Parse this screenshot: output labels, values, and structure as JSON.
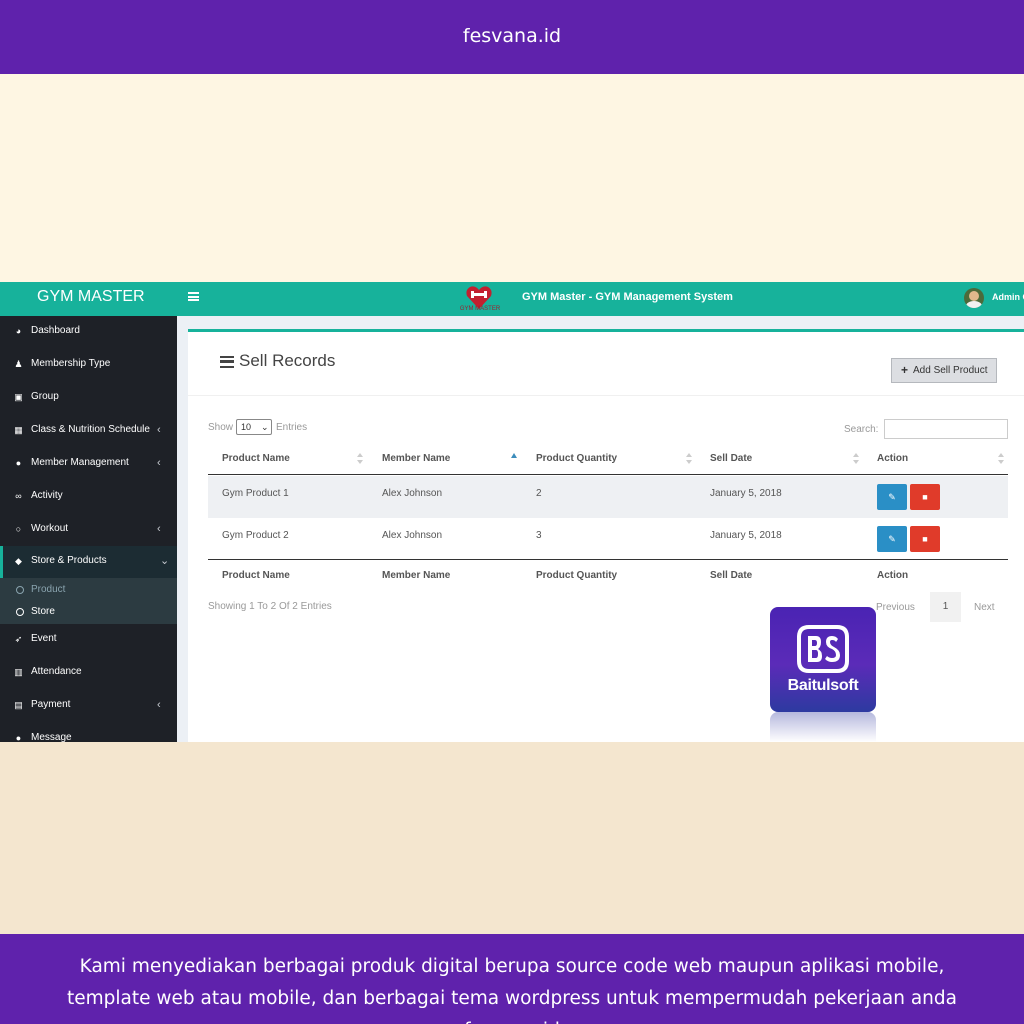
{
  "banner": {
    "top_text": "fesvana.id",
    "bottom_lines": [
      "Kami menyediakan berbagai produk digital berupa source code web maupun aplikasi mobile,",
      "template web atau mobile, dan berbagai tema wordpress untuk mempermudah pekerjaan anda",
      "fesvana.id"
    ]
  },
  "header": {
    "brand": "GYM MASTER",
    "logo_caption": "GYM MASTER",
    "title": "GYM Master - GYM Management System",
    "admin_name": "Admin G",
    "color": "#17b29b"
  },
  "sidebar": {
    "items": [
      {
        "label": "Dashboard",
        "icon": "dashboard-icon",
        "glyph": "◕",
        "has_children": false
      },
      {
        "label": "Membership Type",
        "icon": "users-icon",
        "glyph": "♟",
        "has_children": false
      },
      {
        "label": "Group",
        "icon": "group-icon",
        "glyph": "▣",
        "has_children": false
      },
      {
        "label": "Class & Nutrition Schedule",
        "icon": "calendar-icon",
        "glyph": "▦",
        "has_children": true
      },
      {
        "label": "Member Management",
        "icon": "user-icon",
        "glyph": "●",
        "has_children": true
      },
      {
        "label": "Activity",
        "icon": "bicycle-icon",
        "glyph": "∞",
        "has_children": false
      },
      {
        "label": "Workout",
        "icon": "circle-icon",
        "glyph": "○",
        "has_children": true
      },
      {
        "label": "Store & Products",
        "icon": "tags-icon",
        "glyph": "◆",
        "has_children": true
      },
      {
        "label": "Event",
        "icon": "rocket-icon",
        "glyph": "➶",
        "has_children": false
      },
      {
        "label": "Attendance",
        "icon": "attendance-icon",
        "glyph": "▥",
        "has_children": false
      },
      {
        "label": "Payment",
        "icon": "money-icon",
        "glyph": "▤",
        "has_children": true
      },
      {
        "label": "Message",
        "icon": "comment-icon",
        "glyph": "●",
        "has_children": false
      }
    ],
    "chevron": "‹",
    "chevron_open": "⌄",
    "sub_items": [
      {
        "label": "Product"
      },
      {
        "label": "Store"
      }
    ]
  },
  "page": {
    "title": "Sell Records",
    "add_button": "Add Sell Product",
    "add_icon": "plus-icon",
    "show_label": "Show",
    "entries_value": "10",
    "entries_label": "Entries",
    "search_label": "Search:",
    "search_value": ""
  },
  "table": {
    "columns": [
      "Product Name",
      "Member Name",
      "Product Quantity",
      "Sell Date",
      "Action"
    ],
    "rows": [
      {
        "product": "Gym Product 1",
        "member": "Alex Johnson",
        "quantity": "2",
        "date": "January 5, 2018"
      },
      {
        "product": "Gym Product 2",
        "member": "Alex Johnson",
        "quantity": "3",
        "date": "January 5, 2018"
      }
    ],
    "sorted_column": "Member Name",
    "edit_icon": "edit-icon",
    "delete_icon": "trash-icon"
  },
  "pagination": {
    "info": "Showing 1 To 2 Of 2 Entries",
    "previous": "Previous",
    "current_page": "1",
    "next": "Next"
  },
  "watermark": {
    "monogram": "BS",
    "word": "Baitulsoft"
  }
}
